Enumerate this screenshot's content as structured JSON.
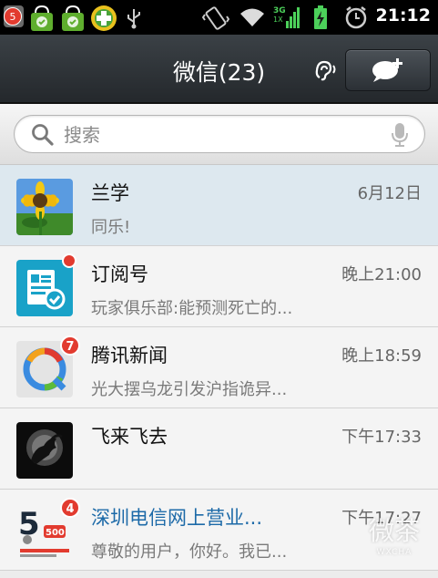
{
  "status_bar": {
    "notification_count": "5",
    "time": "21:12",
    "signal_label": "3G"
  },
  "header": {
    "title": "微信(23)"
  },
  "search": {
    "placeholder": "搜索"
  },
  "chats": [
    {
      "name": "兰学",
      "time": "6月12日",
      "preview": "同乐!",
      "badge": ""
    },
    {
      "name": "订阅号",
      "time": "晚上21:00",
      "preview": "玩家俱乐部:能预测死亡的...",
      "badge": "dot"
    },
    {
      "name": "腾讯新闻",
      "time": "晚上18:59",
      "preview": "光大摆乌龙引发沪指诡异...",
      "badge": "7"
    },
    {
      "name": "飞来飞去",
      "time": "下午17:33",
      "preview": "",
      "badge": ""
    },
    {
      "name": "深圳电信网上营业...",
      "time": "下午17:27",
      "preview": "尊敬的用户，你好。我已...",
      "badge": "4"
    }
  ],
  "avatar_texts": {
    "telecom_number": "5",
    "telecom_sub": "500"
  },
  "watermark": {
    "text": "微茶",
    "sub": "WXCHA"
  },
  "colors": {
    "badge_red": "#e23b2f",
    "selected_row": "#dde8ef",
    "link_blue": "#1d6aa8",
    "titlebar_dark": "#2b3035"
  }
}
